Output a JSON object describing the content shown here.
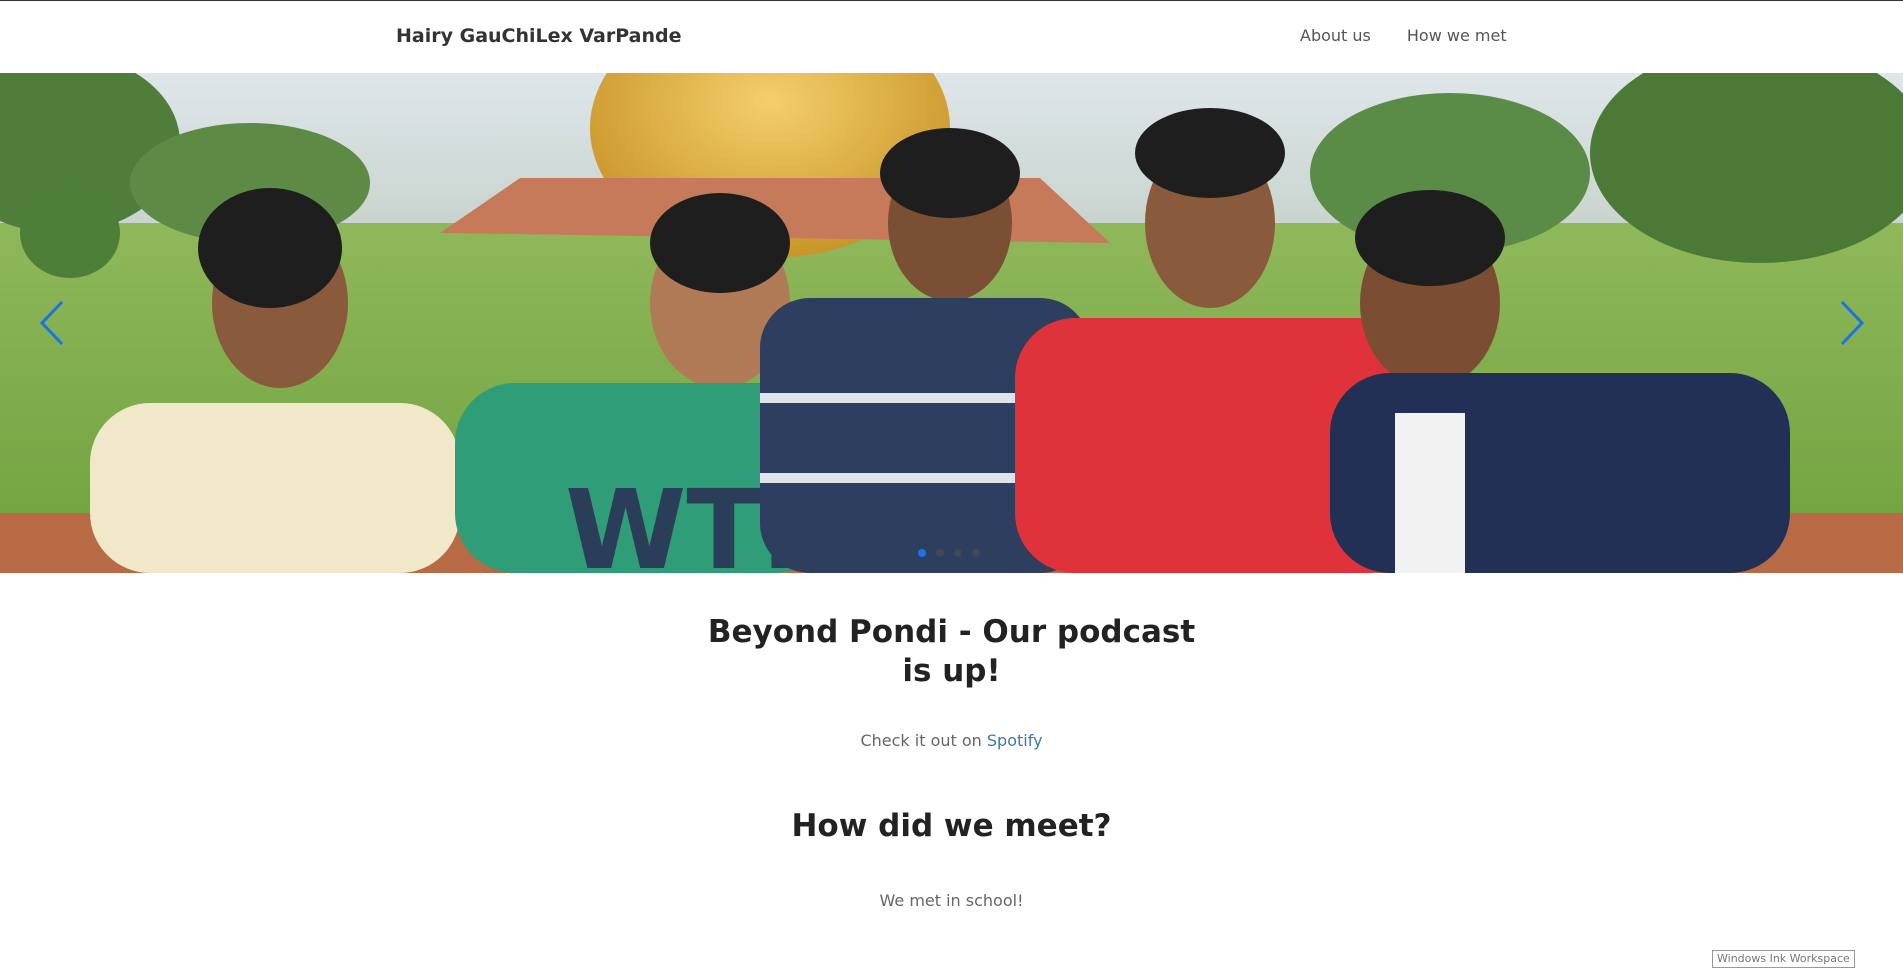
{
  "navbar": {
    "brand": "Hairy GauChiLex VarPande",
    "links": [
      "About us",
      "How we met"
    ]
  },
  "carousel": {
    "indicator_count": 4,
    "active_index": 0,
    "accent_color": "#1a73e8"
  },
  "main": {
    "podcast_heading": "Beyond Pondi - Our podcast is up!",
    "checkout_prefix": "Check it out on ",
    "checkout_link": "Spotify",
    "meet_heading": "How did we meet?",
    "meet_text": "We met in school!"
  },
  "taskbar": {
    "ink_workspace": "Windows Ink Workspace"
  }
}
